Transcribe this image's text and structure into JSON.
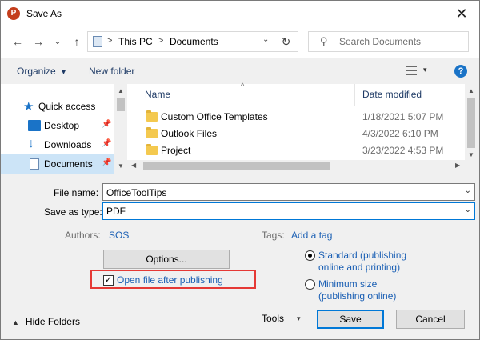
{
  "window": {
    "title": "Save As",
    "app_icon_letter": "P",
    "close_glyph": "✕"
  },
  "nav": {
    "back_glyph": "←",
    "forward_glyph": "→",
    "dropdown_glyph": "⌄",
    "up_glyph": "↑",
    "breadcrumb": [
      "This PC",
      "Documents"
    ],
    "breadcrumb_sep": ">",
    "refresh_glyph": "↻",
    "search_placeholder": "Search Documents",
    "search_glyph": "⚲"
  },
  "toolbar": {
    "organize_label": "Organize",
    "organize_caret": "▾",
    "new_folder_label": "New folder",
    "view_caret": "▾",
    "help_label": "?"
  },
  "sidebar": {
    "items": [
      {
        "label": "Quick access",
        "icon": "star-icon",
        "pinned": false
      },
      {
        "label": "Desktop",
        "icon": "desktop-icon",
        "pinned": true
      },
      {
        "label": "Downloads",
        "icon": "download-icon",
        "pinned": true
      },
      {
        "label": "Documents",
        "icon": "documents-icon",
        "pinned": true,
        "selected": true
      }
    ],
    "pin_glyph": "📌"
  },
  "files": {
    "columns": {
      "name": "Name",
      "date": "Date modified"
    },
    "sort_caret": "^",
    "rows": [
      {
        "name": "Custom Office Templates",
        "date": "1/18/2021 5:07 PM"
      },
      {
        "name": "Outlook Files",
        "date": "4/3/2022 6:10 PM"
      },
      {
        "name": "Project",
        "date": "3/23/2022 4:53 PM"
      }
    ]
  },
  "scroll": {
    "up_glyph": "▲",
    "down_glyph": "▼",
    "left_glyph": "◀",
    "right_glyph": "▶"
  },
  "form": {
    "file_name_label": "File name:",
    "file_name_value": "OfficeToolTips",
    "save_type_label": "Save as type:",
    "save_type_value": "PDF",
    "dropdown_glyph": "⌄",
    "authors_label": "Authors:",
    "authors_value": "SOS",
    "tags_label": "Tags:",
    "tags_value": "Add a tag"
  },
  "options": {
    "options_button": "Options...",
    "open_after_label": "Open file after publishing",
    "open_after_checked": true,
    "check_glyph": "✓",
    "radio_standard_line1": "Standard (publishing",
    "radio_standard_line2": "online and printing)",
    "radio_minimum_line1": "Minimum size",
    "radio_minimum_line2": "(publishing online)",
    "selected_radio": "standard"
  },
  "footer": {
    "hide_folders_label": "Hide Folders",
    "hide_caret": "▲",
    "tools_label": "Tools",
    "tools_caret": "▾",
    "save_label": "Save",
    "cancel_label": "Cancel"
  },
  "colors": {
    "accent": "#0078d7",
    "link": "#1a5fb4",
    "highlight_box": "#e53935",
    "selected_bg": "#cce4f7",
    "folder": "#f4c94f"
  }
}
